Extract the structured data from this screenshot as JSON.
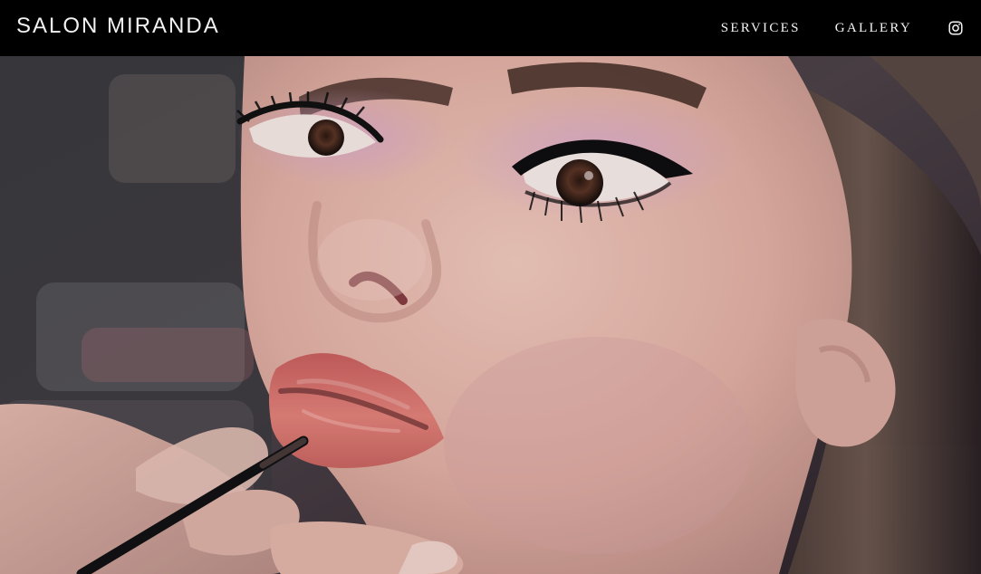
{
  "header": {
    "brand": "SALON MIRANDA",
    "nav": [
      {
        "label": "SERVICES"
      },
      {
        "label": "GALLERY"
      }
    ],
    "social_icon": "instagram-icon"
  },
  "hero": {
    "image": "portrait-makeup-photo"
  },
  "colors": {
    "nav_background": "#000000",
    "nav_text": "#f4f4f4",
    "skin": "#e8b6a8",
    "lips": "#d96f6a",
    "eyeshadow": "#c9a0c8"
  }
}
